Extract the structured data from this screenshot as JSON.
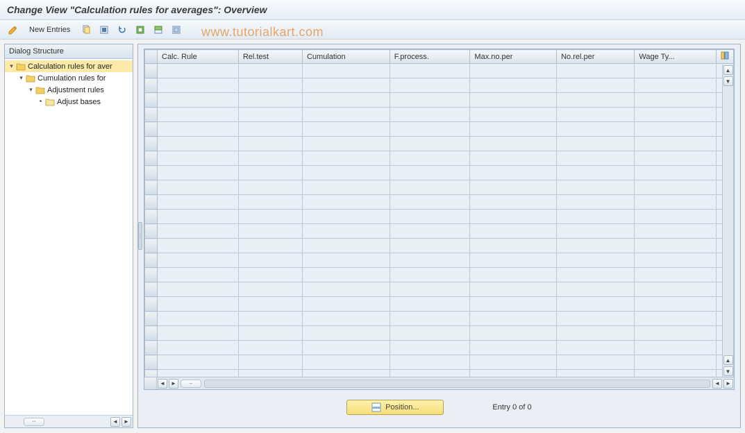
{
  "title": "Change View \"Calculation rules for averages\": Overview",
  "watermark": "www.tutorialkart.com",
  "toolbar": {
    "new_entries_label": "New Entries"
  },
  "sidebar": {
    "header": "Dialog Structure",
    "items": [
      {
        "label": "Calculation rules for aver",
        "level": 0,
        "open": true,
        "selected": true,
        "leaf": false
      },
      {
        "label": "Cumulation rules for",
        "level": 1,
        "open": true,
        "selected": false,
        "leaf": false
      },
      {
        "label": "Adjustment rules",
        "level": 2,
        "open": true,
        "selected": false,
        "leaf": false
      },
      {
        "label": "Adjust bases",
        "level": 3,
        "open": false,
        "selected": false,
        "leaf": true
      }
    ]
  },
  "grid": {
    "columns": [
      "Calc. Rule",
      "Rel.test",
      "Cumulation",
      "F.process.",
      "Max.no.per",
      "No.rel.per",
      "Wage Ty..."
    ],
    "row_count": 22
  },
  "footer": {
    "position_label": "Position...",
    "entry_text": "Entry 0 of 0"
  }
}
